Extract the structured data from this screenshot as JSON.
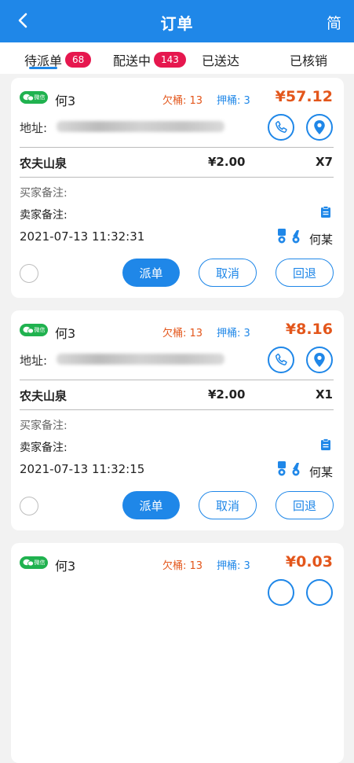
{
  "header": {
    "title": "订单",
    "lang_toggle": "简"
  },
  "tabs": [
    {
      "label": "待派单",
      "badge": "68"
    },
    {
      "label": "配送中",
      "badge": "143"
    },
    {
      "label": "已送达",
      "badge": null
    },
    {
      "label": "已核销",
      "badge": null
    }
  ],
  "colors": {
    "accent": "#1f87e8",
    "danger": "#e3561b",
    "badge": "#e6174e",
    "wechat": "#20b24f"
  },
  "orders": [
    {
      "source_badge": "微信",
      "customer": "何3",
      "owed": "欠桶: 13",
      "deposit": "押桶: 3",
      "total": "¥57.12",
      "address_label": "地址:",
      "product": "农夫山泉",
      "price": "¥2.00",
      "qty": "X7",
      "buyer_note": "买家备注:",
      "seller_note": "卖家备注:",
      "time": "2021-07-13 11:32:31",
      "courier": "何某",
      "btn_dispatch": "派单",
      "btn_cancel": "取消",
      "btn_return": "回退"
    },
    {
      "source_badge": "微信",
      "customer": "何3",
      "owed": "欠桶: 13",
      "deposit": "押桶: 3",
      "total": "¥8.16",
      "address_label": "地址:",
      "product": "农夫山泉",
      "price": "¥2.00",
      "qty": "X1",
      "buyer_note": "买家备注:",
      "seller_note": "卖家备注:",
      "time": "2021-07-13 11:32:15",
      "courier": "何某",
      "btn_dispatch": "派单",
      "btn_cancel": "取消",
      "btn_return": "回退"
    },
    {
      "source_badge": "微信",
      "customer": "何3",
      "owed": "欠桶: 13",
      "deposit": "押桶: 3",
      "total": "¥0.03"
    }
  ]
}
